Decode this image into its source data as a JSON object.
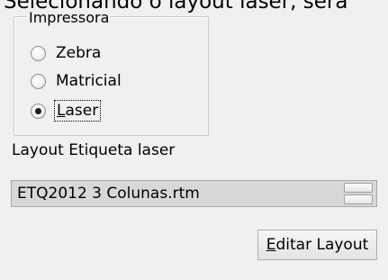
{
  "header_fragment": "Selecionando o layout laser, será",
  "printer_group": {
    "label": "Impressora",
    "options": [
      {
        "label": "Zebra",
        "selected": false
      },
      {
        "label": "Matricial",
        "selected": false
      },
      {
        "label": "Laser",
        "selected": true
      }
    ]
  },
  "layout_field": {
    "label": "Layout Etiqueta laser",
    "selected_value": "ETQ2012 3 Colunas.rtm"
  },
  "actions": {
    "edit_layout_label": "Editar Layout"
  }
}
